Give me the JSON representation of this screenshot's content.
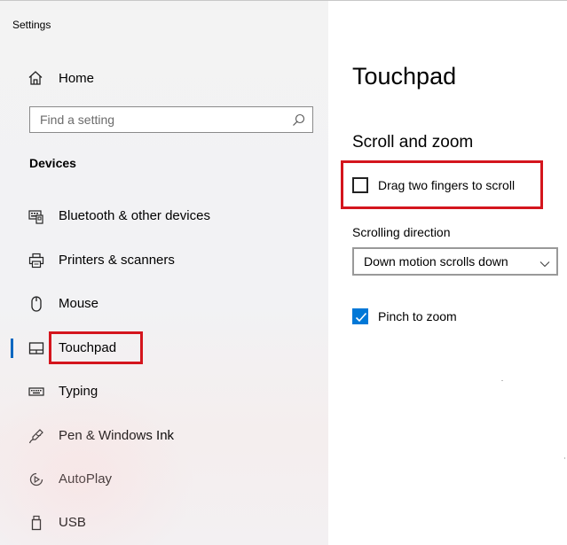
{
  "window": {
    "app_title": "Settings"
  },
  "sidebar": {
    "home": {
      "label": "Home",
      "icon": "home-icon"
    },
    "search": {
      "placeholder": "Find a setting",
      "value": "",
      "icon": "search-icon"
    },
    "section_heading": "Devices",
    "items": [
      {
        "label": "Bluetooth & other devices",
        "icon": "bluetooth-devices-icon",
        "selected": false
      },
      {
        "label": "Printers & scanners",
        "icon": "printer-icon",
        "selected": false
      },
      {
        "label": "Mouse",
        "icon": "mouse-icon",
        "selected": false
      },
      {
        "label": "Touchpad",
        "icon": "touchpad-icon",
        "selected": true
      },
      {
        "label": "Typing",
        "icon": "keyboard-icon",
        "selected": false
      },
      {
        "label": "Pen & Windows Ink",
        "icon": "pen-icon",
        "selected": false
      },
      {
        "label": "AutoPlay",
        "icon": "autoplay-icon",
        "selected": false
      },
      {
        "label": "USB",
        "icon": "usb-icon",
        "selected": false
      }
    ]
  },
  "main": {
    "page_title": "Touchpad",
    "scroll_zoom": {
      "title": "Scroll and zoom",
      "drag_two_fingers": {
        "label": "Drag two fingers to scroll",
        "checked": false
      },
      "scrolling_direction": {
        "label": "Scrolling direction",
        "selected_option": "Down motion scrolls down"
      },
      "pinch_to_zoom": {
        "label": "Pinch to zoom",
        "checked": true
      }
    }
  },
  "colors": {
    "accent": "#0078d7",
    "selection_bar": "#0067c0",
    "highlight_annotation": "#d4151d",
    "sidebar_bg": "#f3f3f3",
    "main_bg": "#ffffff"
  }
}
